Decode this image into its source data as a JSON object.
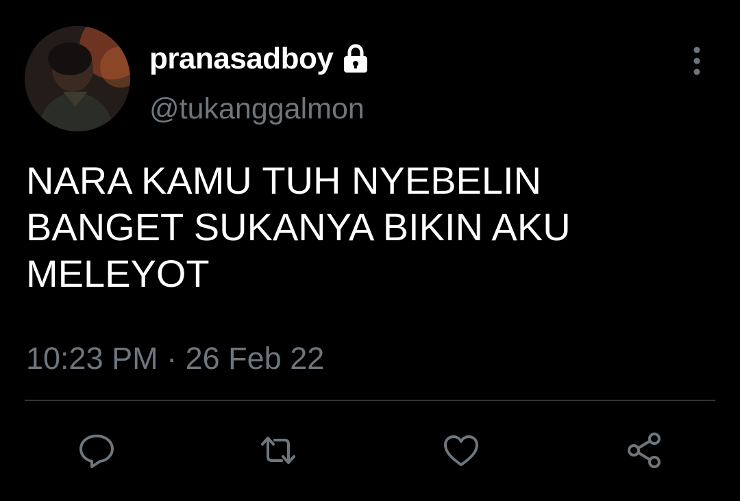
{
  "user": {
    "display_name": "pranasadboy",
    "handle": "@tukanggalmon",
    "protected_icon": "lock-icon",
    "avatar_icon": "avatar"
  },
  "tweet": {
    "text": "NARA KAMU TUH NYEBELIN\nBANGET SUKANYA BIKIN AKU\nMELEYOT",
    "timestamp": "10:23 PM · 26 Feb 22"
  },
  "actions": [
    {
      "name": "reply",
      "icon": "reply-icon"
    },
    {
      "name": "retweet",
      "icon": "retweet-icon"
    },
    {
      "name": "like",
      "icon": "heart-icon"
    },
    {
      "name": "share",
      "icon": "share-icon"
    }
  ],
  "colors": {
    "background": "#000000",
    "primary_text": "#ffffff",
    "secondary_text": "#6e767d",
    "divider": "#2f3336"
  }
}
